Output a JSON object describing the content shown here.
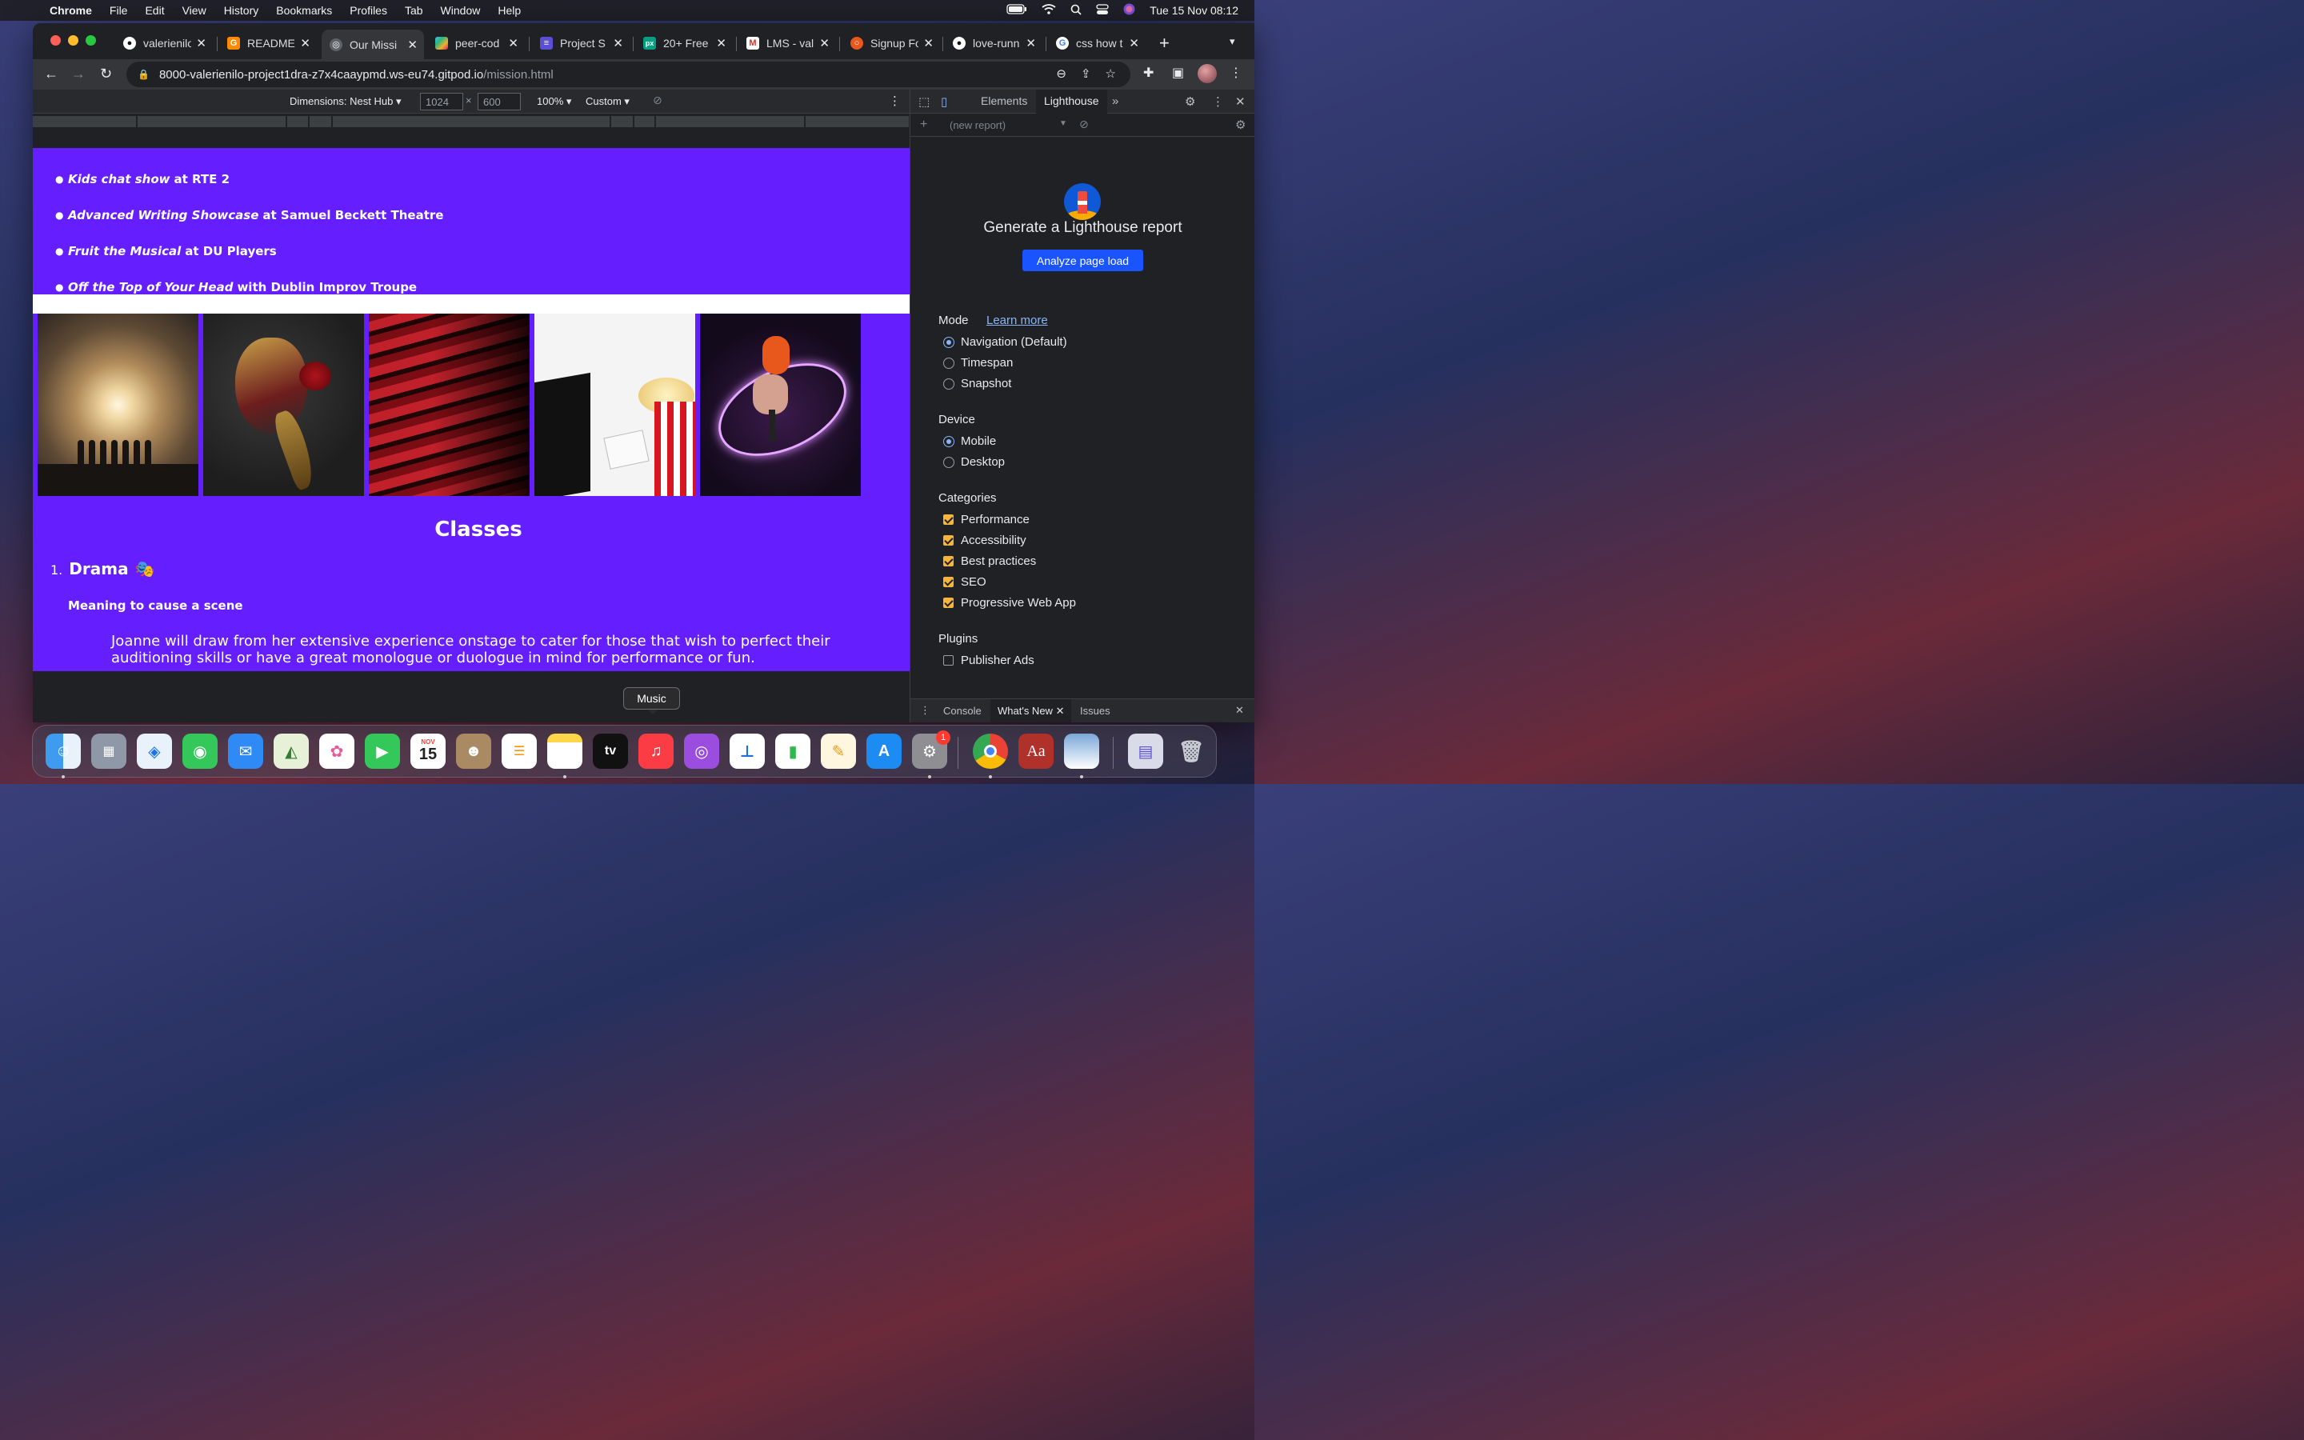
{
  "menubar": {
    "app": "Chrome",
    "items": [
      "File",
      "Edit",
      "View",
      "History",
      "Bookmarks",
      "Profiles",
      "Tab",
      "Window",
      "Help"
    ],
    "clock": "Tue 15 Nov  08:12"
  },
  "browser": {
    "tabs": [
      {
        "title": "valerienilo",
        "icon": "github-icon"
      },
      {
        "title": "README.",
        "icon": "gitpod-icon"
      },
      {
        "title": "Our Missi",
        "icon": "globe-icon",
        "active": true
      },
      {
        "title": "peer-cod",
        "icon": "slack-icon"
      },
      {
        "title": "Project S",
        "icon": "project-icon"
      },
      {
        "title": "20+ Free",
        "icon": "pexels-icon"
      },
      {
        "title": "LMS - val",
        "icon": "gmail-icon"
      },
      {
        "title": "Signup Fo",
        "icon": "signup-icon"
      },
      {
        "title": "love-runn",
        "icon": "github-icon"
      },
      {
        "title": "css how t",
        "icon": "google-icon"
      }
    ],
    "url_host": "8000-valerienilo-project1dra-z7x4caaypmd.ws-eu74.gitpod.io",
    "url_path": "/mission.html"
  },
  "device_toolbar": {
    "dimensions_label": "Dimensions: Nest Hub",
    "width": "1024",
    "height": "600",
    "zoom": "100%",
    "throttle": "Custom"
  },
  "page": {
    "shows": [
      {
        "title": "Kids chat show",
        "venue": "at RTE 2"
      },
      {
        "title": "Advanced Writing Showcase",
        "venue": "at Samuel Beckett Theatre"
      },
      {
        "title": "Fruit the Musical",
        "venue": "at DU Players"
      },
      {
        "title": "Off the Top of Your Head",
        "venue": "with Dublin Improv Troupe"
      }
    ],
    "classes_heading": "Classes",
    "class_number": "1.",
    "class_title": "Drama",
    "class_subheading": "Meaning to cause a scene",
    "class_description": "Joanne will draw from her extensive experience onstage to cater for those that wish to perfect their auditioning skills or have a great monologue or duologue in mind for performance or fun."
  },
  "devtools": {
    "tabs": [
      "Elements",
      "Lighthouse"
    ],
    "active_tab": "Lighthouse",
    "report_placeholder": "(new report)",
    "lighthouse_title": "Generate a Lighthouse report",
    "analyze_button": "Analyze page load",
    "mode_label": "Mode",
    "learn_more": "Learn more",
    "modes": [
      "Navigation (Default)",
      "Timespan",
      "Snapshot"
    ],
    "device_label": "Device",
    "devices": [
      "Mobile",
      "Desktop"
    ],
    "categories_label": "Categories",
    "categories": [
      "Performance",
      "Accessibility",
      "Best practices",
      "SEO",
      "Progressive Web App"
    ],
    "plugins_label": "Plugins",
    "plugins": [
      "Publisher Ads"
    ],
    "drawer_tabs": [
      "Console",
      "What's New",
      "Issues"
    ]
  },
  "dock": {
    "tooltip": "Music",
    "calendar_month": "NOV",
    "calendar_day": "15",
    "settings_badge": "1",
    "tv_label": "tv",
    "dictionary_label": "Aa"
  },
  "colors": {
    "page_purple": "#651fff",
    "lighthouse_button": "#1a54ff",
    "checkbox_orange": "#f6b43b",
    "link_blue": "#8ab4f8"
  }
}
